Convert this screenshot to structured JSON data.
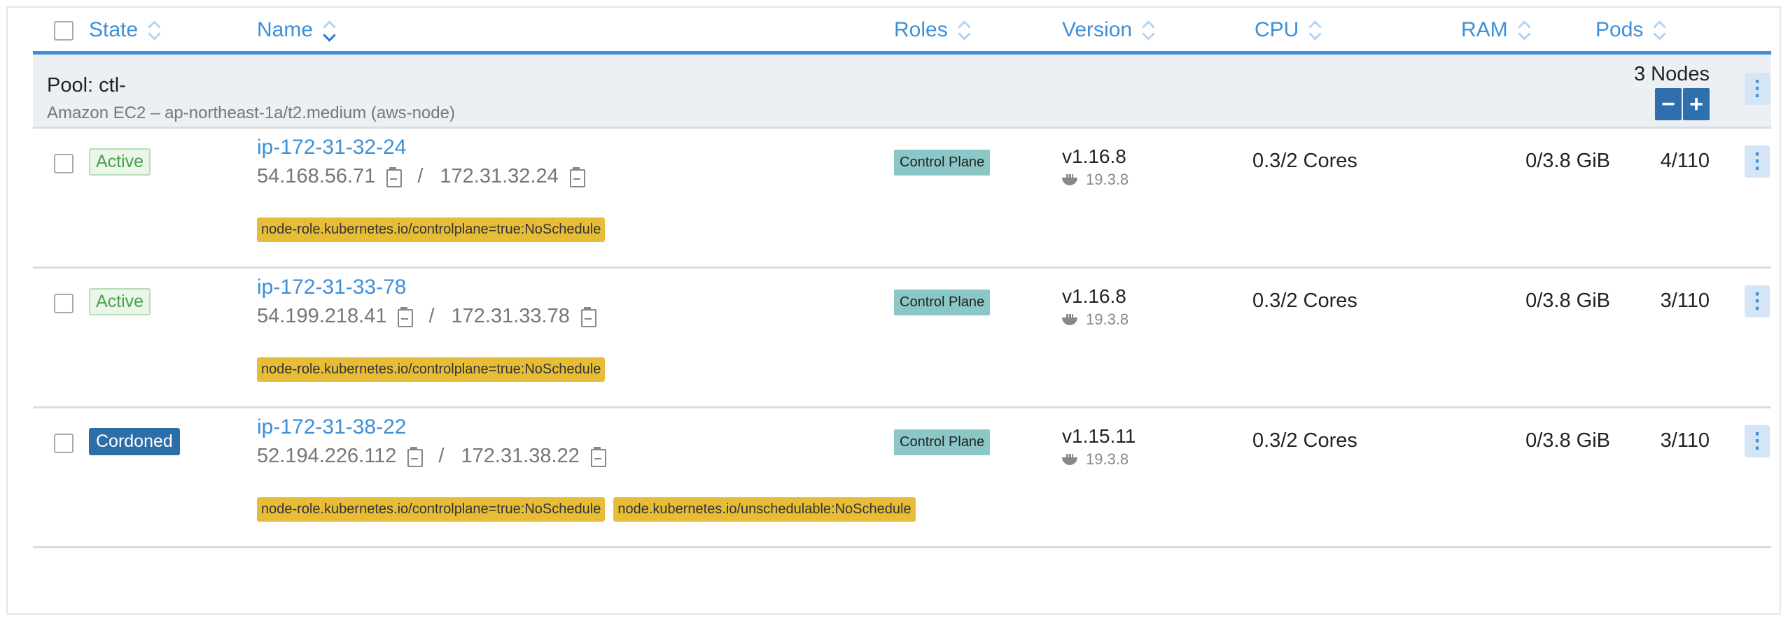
{
  "columns": {
    "state": "State",
    "name": "Name",
    "roles": "Roles",
    "version": "Version",
    "cpu": "CPU",
    "ram": "RAM",
    "pods": "Pods"
  },
  "pool": {
    "title": "Pool: ctl-",
    "subtitle": "Amazon EC2 – ap-northeast-1a/t2.medium (aws-node)",
    "count": "3 Nodes",
    "scale_down": "−",
    "scale_up": "+"
  },
  "nodes": [
    {
      "state": "Active",
      "name": "ip-172-31-32-24",
      "public_ip": "54.168.56.71",
      "private_ip": "172.31.32.24",
      "separator": "/",
      "role": "Control Plane",
      "version": "v1.16.8",
      "docker": "19.3.8",
      "cpu": "0.3/2 Cores",
      "ram": "0/3.8 GiB",
      "pods": "4/110",
      "taints": [
        "node-role.kubernetes.io/controlplane=true:NoSchedule"
      ]
    },
    {
      "state": "Active",
      "name": "ip-172-31-33-78",
      "public_ip": "54.199.218.41",
      "private_ip": "172.31.33.78",
      "separator": "/",
      "role": "Control Plane",
      "version": "v1.16.8",
      "docker": "19.3.8",
      "cpu": "0.3/2 Cores",
      "ram": "0/3.8 GiB",
      "pods": "3/110",
      "taints": [
        "node-role.kubernetes.io/controlplane=true:NoSchedule"
      ]
    },
    {
      "state": "Cordoned",
      "name": "ip-172-31-38-22",
      "public_ip": "52.194.226.112",
      "private_ip": "172.31.38.22",
      "separator": "/",
      "role": "Control Plane",
      "version": "v1.15.11",
      "docker": "19.3.8",
      "cpu": "0.3/2 Cores",
      "ram": "0/3.8 GiB",
      "pods": "3/110",
      "taints": [
        "node-role.kubernetes.io/controlplane=true:NoSchedule",
        "node.kubernetes.io/unschedulable:NoSchedule"
      ]
    }
  ],
  "colors": {
    "accent": "#3d8fd8",
    "active_text": "#4aa04a",
    "cordoned_bg": "#2d6ea8",
    "taint_bg": "#e7bd37",
    "role_bg": "#8cc7c7"
  }
}
